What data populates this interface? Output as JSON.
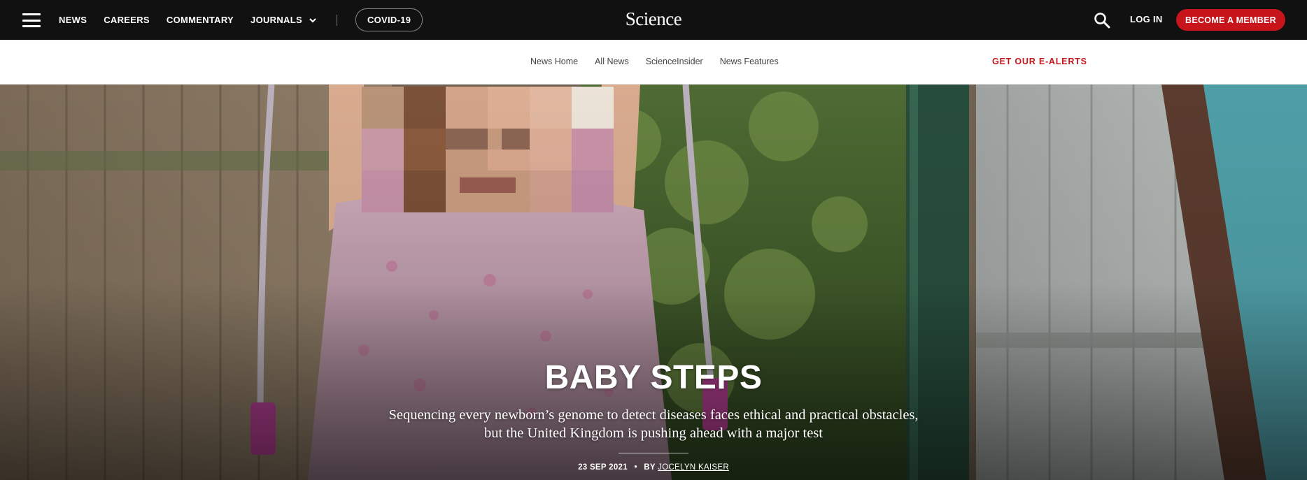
{
  "header": {
    "logo": "Science",
    "nav": [
      {
        "label": "NEWS"
      },
      {
        "label": "CAREERS"
      },
      {
        "label": "COMMENTARY"
      },
      {
        "label": "JOURNALS"
      }
    ],
    "covid_label": "COVID-19",
    "login_label": "LOG IN",
    "member_label": "BECOME A MEMBER",
    "icons": {
      "menu": "hamburger-menu-icon",
      "search": "search-icon",
      "journals_dropdown": "chevron-down-icon"
    }
  },
  "subnav": {
    "links": [
      {
        "label": "News Home"
      },
      {
        "label": "All News"
      },
      {
        "label": "ScienceInsider"
      },
      {
        "label": "News Features"
      }
    ],
    "ealerts_label": "GET OUR E-ALERTS"
  },
  "hero": {
    "title": "BABY STEPS",
    "dek": "Sequencing every newborn’s genome to detect diseases faces ethical and practical obstacles, but the United Kingdom is pushing ahead with a major test",
    "date": "23 SEP 2021",
    "by_prefix": "BY",
    "author": "JOCELYN KAISER"
  },
  "colors": {
    "topbar_bg": "#111111",
    "accent_red": "#c8151b",
    "subnav_text": "#444444"
  }
}
